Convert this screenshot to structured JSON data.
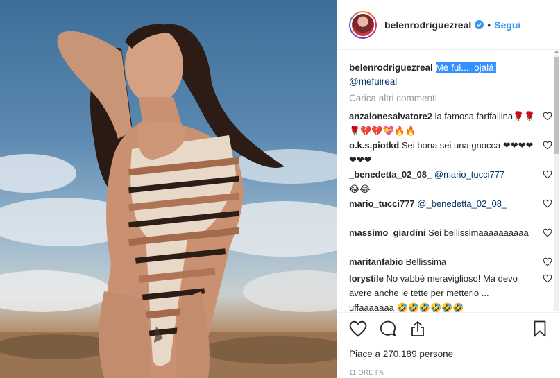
{
  "header": {
    "username": "belenrodriguezreal",
    "separator": "•",
    "follow_label": "Segui"
  },
  "caption": {
    "user": "belenrodriguezreal",
    "text": "Me fui.... ojalá!",
    "mention": "@mefuireal"
  },
  "load_more": "Carica altri commenti",
  "comments": [
    {
      "user": "anzalonesalvatore2",
      "text": "la famosa farffallina🌹🌹🌹💔💔💝🔥🔥"
    },
    {
      "user": "o.k.s.piotkd",
      "text": "Sei bona sei una gnocca ❤❤❤❤❤❤❤"
    },
    {
      "user": "_benedetta_02_08_",
      "mention": "@mario_tucci777",
      "text": "😂😂"
    },
    {
      "user": "mario_tucci777",
      "mention": "@_benedetta_02_08_",
      "text": ""
    },
    {
      "user": "massimo_giardini",
      "text": "Sei bellissimaaaaaaaaaa"
    },
    {
      "user": "maritanfabio",
      "text": "Bellissima"
    },
    {
      "user": "lorystile",
      "text": "No vabbè meraviglioso! Ma devo avere anche le tette per metterlo ... uffaaaaaaa 🤣🤣🤣🤣🤣🤣"
    }
  ],
  "likes": "Piace a 270.189 persone",
  "timestamp": "11 ORE FA",
  "icons": [
    "heart-icon",
    "comment-icon",
    "share-icon",
    "save-icon",
    "verified-icon",
    "like-comment-icon"
  ],
  "colors": {
    "link": "#3897f0",
    "mention": "#003569",
    "muted": "#999999",
    "highlight": "#3390ff"
  }
}
